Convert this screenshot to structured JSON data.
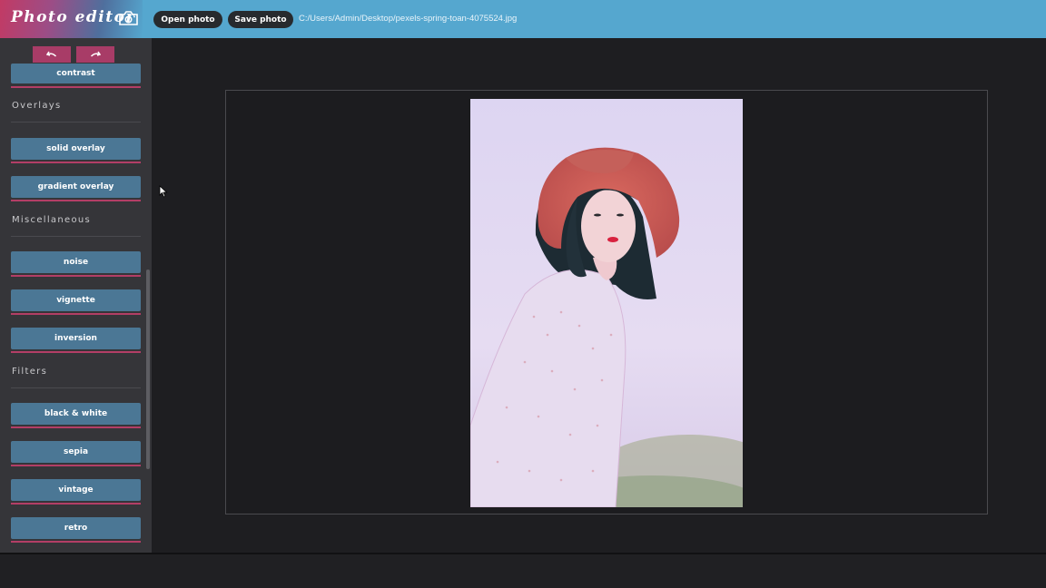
{
  "app": {
    "title": "Photo editor",
    "logo_icon": "camera-icon"
  },
  "toolbar": {
    "open_label": "Open photo",
    "save_label": "Save photo",
    "file_path": "C:/Users/Admin/Desktop/pexels-spring-toan-4075524.jpg"
  },
  "history": {
    "undo_icon": "undo-icon",
    "redo_icon": "redo-icon"
  },
  "sidebar": {
    "partial_item": "contrast",
    "sections": [
      {
        "title": "Overlays",
        "items": [
          "solid overlay",
          "gradient overlay"
        ]
      },
      {
        "title": "Miscellaneous",
        "items": [
          "noise",
          "vignette",
          "inversion"
        ]
      },
      {
        "title": "Filters",
        "items": [
          "black & white",
          "sepia",
          "vintage",
          "retro"
        ]
      }
    ]
  },
  "colors": {
    "topbar": "#55a7cf",
    "button": "#4b7795",
    "accent": "#b33e66",
    "sidebar": "#353539",
    "workspace": "#1e1e21"
  }
}
